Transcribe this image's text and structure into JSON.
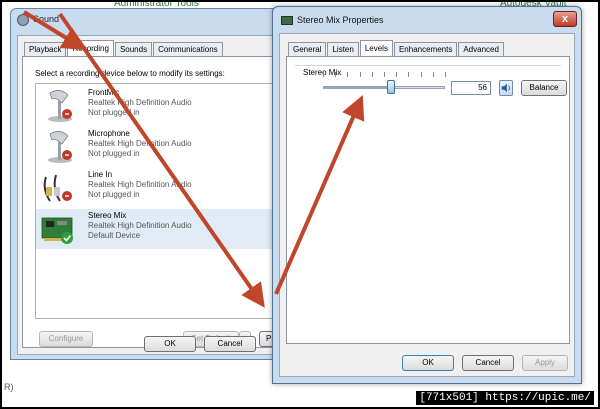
{
  "background": {
    "top_fragment_1": "Administrator Tools",
    "top_fragment_2": "Autodesk Vault",
    "left_fragment": "R)"
  },
  "sound_window": {
    "title": "Sound",
    "tabs": [
      {
        "label": "Playback",
        "active": false
      },
      {
        "label": "Recording",
        "active": true
      },
      {
        "label": "Sounds",
        "active": false
      },
      {
        "label": "Communications",
        "active": false
      }
    ],
    "instruction": "Select a recording device below to modify its settings:",
    "devices": [
      {
        "name": "FrontMic",
        "driver": "Realtek High Definition Audio",
        "status": "Not plugged in",
        "icon": "microphone-icon",
        "selected": false
      },
      {
        "name": "Microphone",
        "driver": "Realtek High Definition Audio",
        "status": "Not plugged in",
        "icon": "microphone-icon",
        "selected": false
      },
      {
        "name": "Line In",
        "driver": "Realtek High Definition Audio",
        "status": "Not plugged in",
        "icon": "line-in-cable-icon",
        "selected": false
      },
      {
        "name": "Stereo Mix",
        "driver": "Realtek High Definition Audio",
        "status": "Default Device",
        "icon": "sound-card-icon",
        "selected": true
      }
    ],
    "configure_label": "Configure",
    "set_default_label": "Set Default",
    "properties_label": "Pro",
    "ok_label": "OK",
    "cancel_label": "Cancel"
  },
  "properties_window": {
    "title": "Stereo Mix Properties",
    "close_glyph": "x",
    "tabs": [
      {
        "label": "General",
        "active": false
      },
      {
        "label": "Listen",
        "active": false
      },
      {
        "label": "Levels",
        "active": true
      },
      {
        "label": "Enhancements",
        "active": false
      },
      {
        "label": "Advanced",
        "active": false
      }
    ],
    "group_label": "Stereo Mix",
    "volume_value": "56",
    "volume_level": 0.56,
    "balance_label": "Balance",
    "ok_label": "OK",
    "cancel_label": "Cancel",
    "apply_label": "Apply"
  },
  "colors": {
    "arrow": "#c0462a",
    "window_frame": "#c9dcef",
    "selected_row": "#e1ebf6",
    "default_check": "#2e9e3a",
    "unplugged_badge": "#c0392b"
  },
  "watermark": "[771x501] https://upic.me/"
}
